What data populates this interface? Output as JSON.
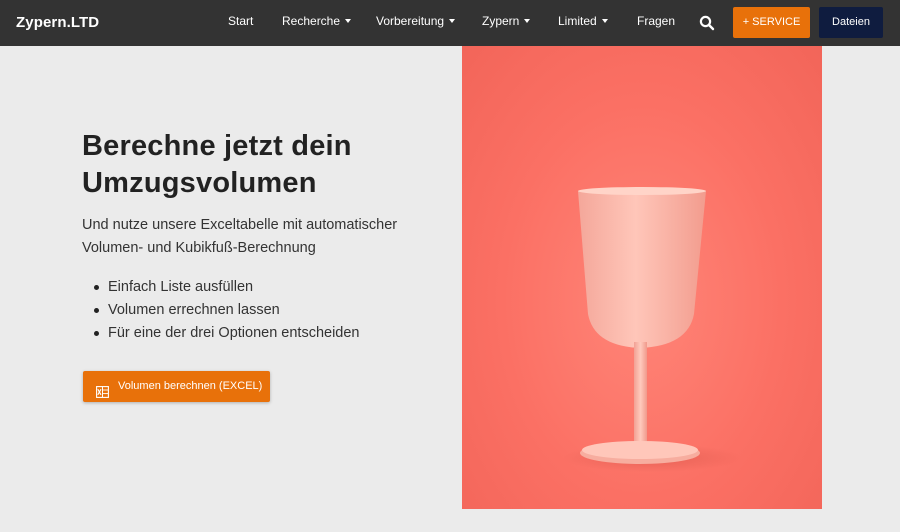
{
  "brand": "Zypern.LTD",
  "nav": {
    "items": [
      {
        "label": "Start",
        "dropdown": false
      },
      {
        "label": "Recherche",
        "dropdown": true
      },
      {
        "label": "Vorbereitung",
        "dropdown": true
      },
      {
        "label": "Zypern",
        "dropdown": true
      },
      {
        "label": "Limited",
        "dropdown": true
      },
      {
        "label": "Fragen",
        "dropdown": false
      }
    ],
    "search_icon": "search-icon",
    "service_button": "+ SERVICE",
    "dateien_button": "Dateien"
  },
  "hero": {
    "title": "Berechne jetzt dein Umzugsvolumen",
    "subtitle": "Und nutze unsere Exceltabelle mit automatischer Volumen- und Kubikfuß-Berechnung",
    "bullets": [
      "Einfach Liste ausfüllen",
      "Volumen errechnen lassen",
      "Für eine der drei Optionen entscheiden"
    ],
    "cta_label": "Volumen berechnen (EXCEL)",
    "cta_icon": "excel-icon",
    "image_subject": "pink-wine-glass"
  },
  "colors": {
    "nav_bg": "#333333",
    "accent_orange": "#e8710a",
    "navy": "#0f1c3f",
    "page_bg": "#ebebeb",
    "coral": "#fb7064"
  }
}
